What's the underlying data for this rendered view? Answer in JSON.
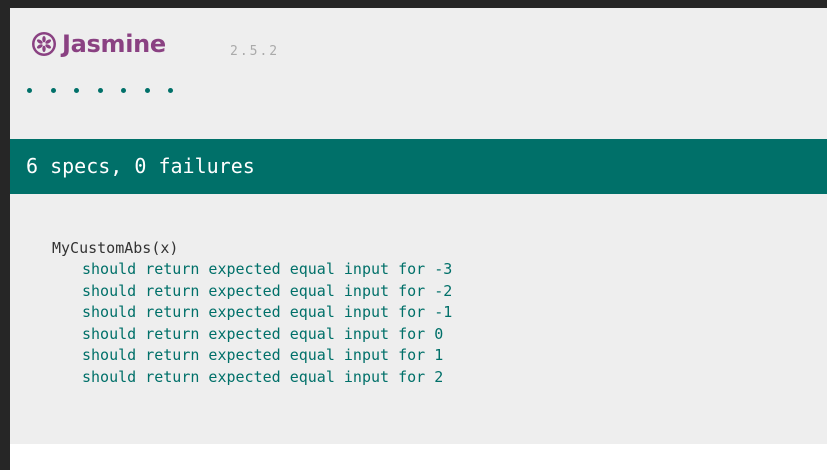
{
  "banner": {
    "title": "Jasmine",
    "version": "2.5.2",
    "dot_count": 7,
    "icon": "jasmine-flower-icon"
  },
  "summary": {
    "text": "6 specs, 0 failures"
  },
  "suite": {
    "name": "MyCustomAbs(x)",
    "specs": [
      "should return expected equal input for -3",
      "should return expected equal input for -2",
      "should return expected equal input for -1",
      "should return expected equal input for 0",
      "should return expected equal input for 1",
      "should return expected equal input for 2"
    ]
  },
  "colors": {
    "brand": "#8a4182",
    "passed": "#007069",
    "background": "#eeeeee"
  }
}
